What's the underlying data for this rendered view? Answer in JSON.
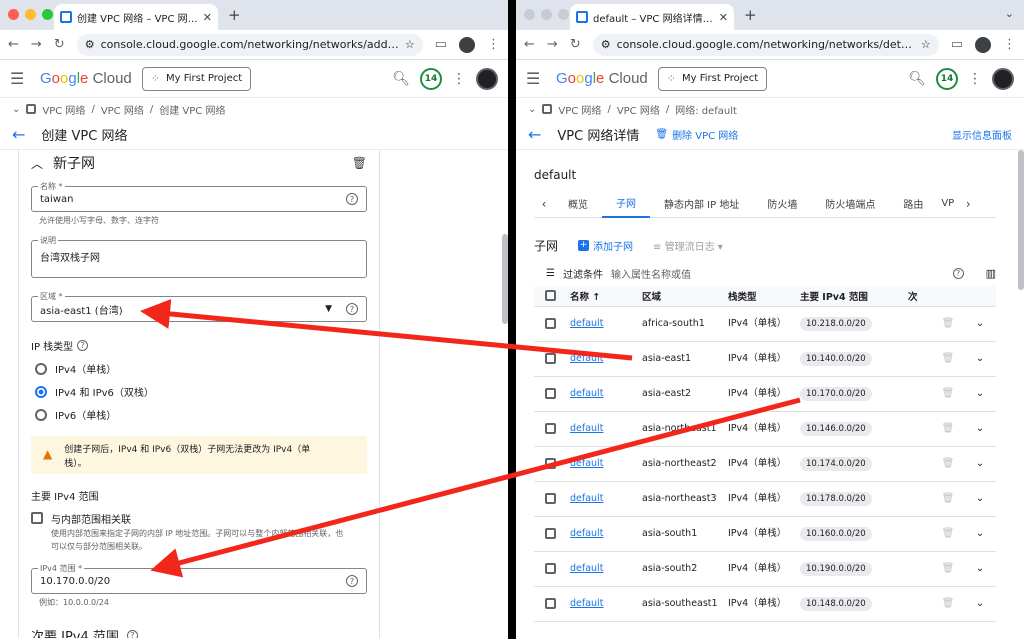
{
  "left": {
    "tab_title": "创建 VPC 网络 – VPC 网络 – M",
    "url": "console.cloud.google.com/networking/networks/add?i...",
    "project": "My First Project",
    "badge": "14",
    "breadcrumb": [
      "VPC 网络",
      "VPC 网络",
      "创建 VPC 网络"
    ],
    "page_title": "创建 VPC 网络",
    "section_title": "新子网",
    "name_label": "名称 *",
    "name_value": "taiwan",
    "name_hint": "允许使用小写字母、数字、连字符",
    "desc_label": "说明",
    "desc_value": "台湾双栈子网",
    "region_label": "区域 *",
    "region_value": "asia-east1 (台湾)",
    "ip_stack_label": "IP 栈类型",
    "radio_ipv4": "IPv4（单栈）",
    "radio_dual": "IPv4 和 IPv6（双栈）",
    "radio_ipv6": "IPv6（单栈）",
    "warning_line1": "创建子网后，IPv4 和 IPv6（双栈）子网无法更改为 IPv4（单",
    "warning_line2": "栈）。",
    "primary_range_label": "主要 IPv4 范围",
    "assoc_label": "与内部范围相关联",
    "assoc_desc1": "使用内部范围来指定子网的内部 IP 地址范围。子网可以与整个内部范围相关联，也",
    "assoc_desc2": "可以仅与部分范围相关联。",
    "ipv4_range_label": "IPv4 范围 *",
    "ipv4_range_value": "10.170.0.0/20",
    "ipv4_example": "例如：10.0.0.0/24",
    "secondary_label": "次要 IPv4 范围"
  },
  "right": {
    "tab_title": "default – VPC 网络详情 – VPC",
    "url": "console.cloud.google.com/networking/networks/detail...",
    "project": "My First Project",
    "badge": "14",
    "breadcrumb": [
      "VPC 网络",
      "VPC 网络",
      "网络: default"
    ],
    "page_title": "VPC 网络详情",
    "delete_label": "删除 VPC 网络",
    "info_panel": "显示信息面板",
    "network_name": "default",
    "tabs": [
      "概览",
      "子网",
      "静态内部 IP 地址",
      "防火墙",
      "防火墙端点",
      "路由",
      "VP"
    ],
    "subnet_title": "子网",
    "add_subnet": "添加子网",
    "flow_logs": "管理流日志",
    "filter_label": "过滤条件",
    "filter_placeholder": "输入属性名称或值",
    "columns": [
      "名称",
      "区域",
      "栈类型",
      "主要 IPv4 范围",
      "次"
    ],
    "rows": [
      {
        "name": "default",
        "region": "africa-south1",
        "stack": "IPv4（单栈）",
        "range": "10.218.0.0/20"
      },
      {
        "name": "default",
        "region": "asia-east1",
        "stack": "IPv4（单栈）",
        "range": "10.140.0.0/20"
      },
      {
        "name": "default",
        "region": "asia-east2",
        "stack": "IPv4（单栈）",
        "range": "10.170.0.0/20"
      },
      {
        "name": "default",
        "region": "asia-northeast1",
        "stack": "IPv4（单栈）",
        "range": "10.146.0.0/20"
      },
      {
        "name": "default",
        "region": "asia-northeast2",
        "stack": "IPv4（单栈）",
        "range": "10.174.0.0/20"
      },
      {
        "name": "default",
        "region": "asia-northeast3",
        "stack": "IPv4（单栈）",
        "range": "10.178.0.0/20"
      },
      {
        "name": "default",
        "region": "asia-south1",
        "stack": "IPv4（单栈）",
        "range": "10.160.0.0/20"
      },
      {
        "name": "default",
        "region": "asia-south2",
        "stack": "IPv4（单栈）",
        "range": "10.190.0.0/20"
      },
      {
        "name": "default",
        "region": "asia-southeast1",
        "stack": "IPv4（单栈）",
        "range": "10.148.0.0/20"
      }
    ]
  },
  "colors": {
    "accent": "#1a73e8",
    "arrow": "#f2261b",
    "warning_bg": "#fef7e0",
    "badge": "#1e8e3e"
  }
}
